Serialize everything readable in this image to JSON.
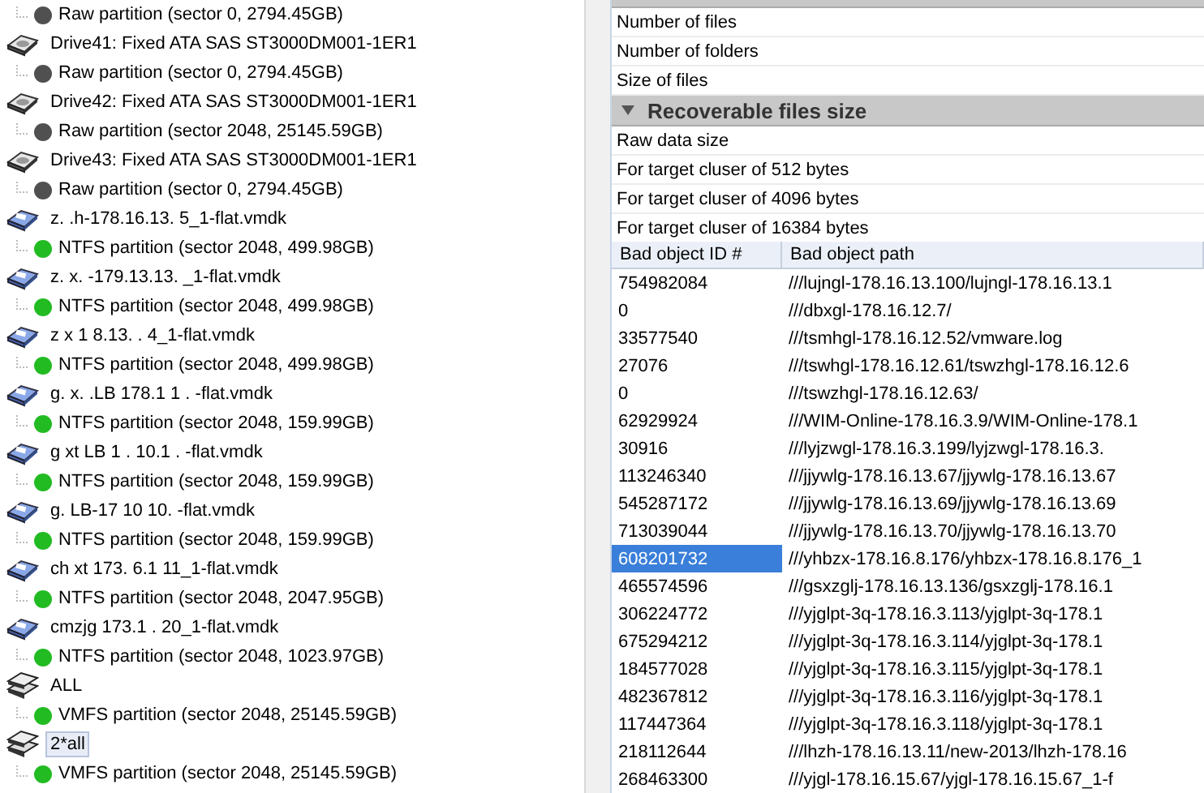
{
  "tree": {
    "items": [
      {
        "kind": "partition",
        "label": "Raw partition (sector 0, 2794.45GB)",
        "color": "#505050"
      },
      {
        "kind": "drive",
        "label": "Drive41: Fixed ATA SAS ST3000DM001-1ER1",
        "selected": false,
        "children": [
          {
            "kind": "partition",
            "label": "Raw partition (sector 0, 2794.45GB)",
            "color": "#505050"
          }
        ]
      },
      {
        "kind": "drive",
        "label": "Drive42: Fixed ATA SAS ST3000DM001-1ER1",
        "selected": false,
        "children": [
          {
            "kind": "partition",
            "label": "Raw partition (sector 2048, 25145.59GB)",
            "color": "#505050"
          }
        ]
      },
      {
        "kind": "drive",
        "label": "Drive43: Fixed ATA SAS ST3000DM001-1ER1",
        "selected": false,
        "children": [
          {
            "kind": "partition",
            "label": "Raw partition (sector 0, 2794.45GB)",
            "color": "#505050"
          }
        ]
      },
      {
        "kind": "image",
        "label": "z.  .h-178.16.13. 5_1-flat.vmdk",
        "selected": false,
        "children": [
          {
            "kind": "partition",
            "label": "NTFS partition (sector 2048, 499.98GB)",
            "color": "#22bb22"
          }
        ]
      },
      {
        "kind": "image",
        "label": "z. x. -179.13.13. _1-flat.vmdk",
        "selected": false,
        "children": [
          {
            "kind": "partition",
            "label": "NTFS partition (sector 2048, 499.98GB)",
            "color": "#22bb22"
          }
        ]
      },
      {
        "kind": "image",
        "label": "z  x  1 8.13.  . 4_1-flat.vmdk",
        "selected": false,
        "children": [
          {
            "kind": "partition",
            "label": "NTFS partition (sector 2048, 499.98GB)",
            "color": "#22bb22"
          }
        ]
      },
      {
        "kind": "image",
        "label": "g. x. .LB 178.1  1  . -flat.vmdk",
        "selected": false,
        "children": [
          {
            "kind": "partition",
            "label": "NTFS partition (sector 2048, 159.99GB)",
            "color": "#22bb22"
          }
        ]
      },
      {
        "kind": "image",
        "label": "g  xt LB 1 . 10.1 . -flat.vmdk",
        "selected": false,
        "children": [
          {
            "kind": "partition",
            "label": "NTFS partition (sector 2048, 159.99GB)",
            "color": "#22bb22"
          }
        ]
      },
      {
        "kind": "image",
        "label": "g.   LB-17  10 10.  -flat.vmdk",
        "selected": false,
        "children": [
          {
            "kind": "partition",
            "label": "NTFS partition (sector 2048, 159.99GB)",
            "color": "#22bb22"
          }
        ]
      },
      {
        "kind": "image",
        "label": "ch xt 173. 6.1  11_1-flat.vmdk",
        "selected": false,
        "children": [
          {
            "kind": "partition",
            "label": "NTFS partition (sector 2048, 2047.95GB)",
            "color": "#22bb22"
          }
        ]
      },
      {
        "kind": "image",
        "label": "cmzjg  173.1   . 20_1-flat.vmdk",
        "selected": false,
        "children": [
          {
            "kind": "partition",
            "label": "NTFS partition (sector 2048, 1023.97GB)",
            "color": "#22bb22"
          }
        ]
      },
      {
        "kind": "array",
        "label": "ALL",
        "selected": false,
        "children": [
          {
            "kind": "partition",
            "label": "VMFS partition (sector 2048, 25145.59GB)",
            "color": "#22bb22"
          }
        ]
      },
      {
        "kind": "array",
        "label": "2*all",
        "selected": true,
        "children": [
          {
            "kind": "partition",
            "label": "VMFS partition (sector 2048, 25145.59GB)",
            "color": "#22bb22"
          }
        ]
      }
    ]
  },
  "properties": {
    "sections": [
      {
        "expanded": true,
        "rows": [
          "Number of files",
          "Number of folders",
          "Size of files"
        ]
      },
      {
        "title": "Recoverable files size",
        "expanded": true,
        "rows": [
          "Raw data size",
          "For target cluser of 512 bytes",
          "For target cluser of 4096 bytes",
          "For target cluser of 16384 bytes"
        ]
      }
    ]
  },
  "bad_objects": {
    "columns": [
      "Bad object ID #",
      "Bad object path"
    ],
    "rows": [
      {
        "id": "754982084",
        "path": "///lujngl-178.16.13.100/lujngl-178.16.13.1",
        "selected": false
      },
      {
        "id": "0",
        "path": "///dbxgl-178.16.12.7/",
        "selected": false
      },
      {
        "id": "33577540",
        "path": "///tsmhgl-178.16.12.52/vmware.log",
        "selected": false
      },
      {
        "id": "27076",
        "path": "///tswhgl-178.16.12.61/tswzhgl-178.16.12.6",
        "selected": false
      },
      {
        "id": "0",
        "path": "///tswzhgl-178.16.12.63/",
        "selected": false
      },
      {
        "id": "62929924",
        "path": "///WIM-Online-178.16.3.9/WIM-Online-178.1",
        "selected": false
      },
      {
        "id": "30916",
        "path": "///lyjzwgl-178.16.3.199/lyjzwgl-178.16.3.",
        "selected": false
      },
      {
        "id": "113246340",
        "path": "///jjywlg-178.16.13.67/jjywlg-178.16.13.67",
        "selected": false
      },
      {
        "id": "545287172",
        "path": "///jjywlg-178.16.13.69/jjywlg-178.16.13.69",
        "selected": false
      },
      {
        "id": "713039044",
        "path": "///jjywlg-178.16.13.70/jjywlg-178.16.13.70",
        "selected": false
      },
      {
        "id": "608201732",
        "path": "///yhbzx-178.16.8.176/yhbzx-178.16.8.176_1",
        "selected": true
      },
      {
        "id": "465574596",
        "path": "///gsxzglj-178.16.13.136/gsxzglj-178.16.1",
        "selected": false
      },
      {
        "id": "306224772",
        "path": "///yjglpt-3q-178.16.3.113/yjglpt-3q-178.1",
        "selected": false
      },
      {
        "id": "675294212",
        "path": "///yjglpt-3q-178.16.3.114/yjglpt-3q-178.1",
        "selected": false
      },
      {
        "id": "184577028",
        "path": "///yjglpt-3q-178.16.3.115/yjglpt-3q-178.1",
        "selected": false
      },
      {
        "id": "482367812",
        "path": "///yjglpt-3q-178.16.3.116/yjglpt-3q-178.1",
        "selected": false
      },
      {
        "id": "117447364",
        "path": "///yjglpt-3q-178.16.3.118/yjglpt-3q-178.1",
        "selected": false
      },
      {
        "id": "218112644",
        "path": "///lhzh-178.16.13.11/new-2013/lhzh-178.16",
        "selected": false
      },
      {
        "id": "268463300",
        "path": "///yjgl-178.16.15.67/yjgl-178.16.15.67_1-f",
        "selected": false
      }
    ]
  }
}
